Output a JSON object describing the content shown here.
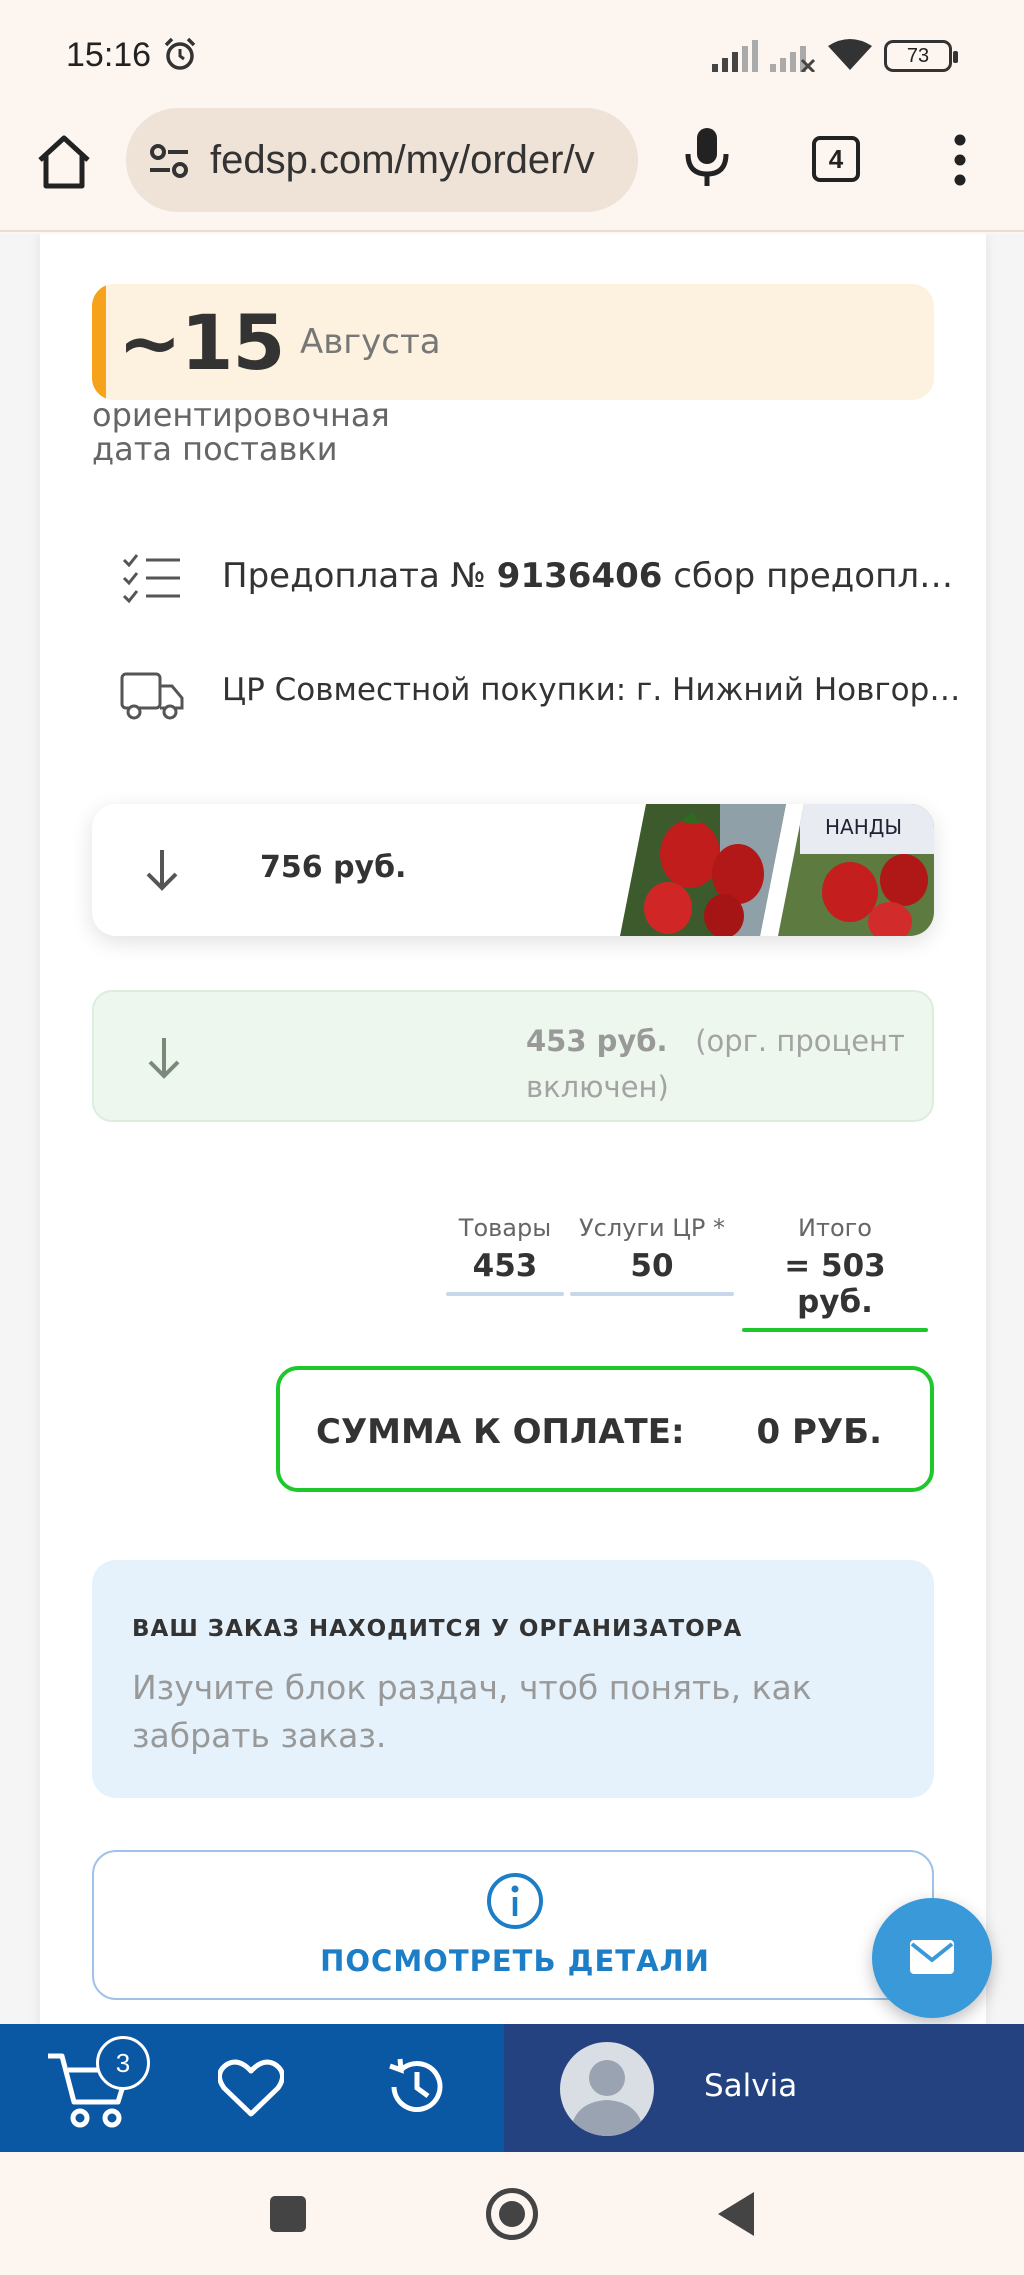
{
  "status_bar": {
    "time": "15:16",
    "battery": "73",
    "icons": [
      "alarm-icon",
      "signal-icon",
      "signal-no-data-icon",
      "wifi-icon",
      "battery-icon"
    ]
  },
  "browser": {
    "url": "fedsp.com/my/order/v",
    "tab_count": "4",
    "icons": [
      "home-icon",
      "site-settings-icon",
      "microphone-icon",
      "tabs-icon",
      "more-menu-icon"
    ]
  },
  "order": {
    "delivery": {
      "day": "~15",
      "month": "Августа",
      "caption_line1": "ориентировочная",
      "caption_line2": "дата поставки"
    },
    "prepay": {
      "prefix": "Предоплата № ",
      "number": "9136406",
      "suffix": " сбор предоплаты"
    },
    "pickup": "ЦР Совместной покупки: г. Нижний Новгород,",
    "item_price": "756 руб.",
    "org_price": "453 руб.",
    "org_note": "(орг. процент включен)",
    "totals": {
      "goods_label": "Товары",
      "goods_value": "453",
      "services_label": "Услуги ЦР *",
      "services_value": "50",
      "total_label": "Итого",
      "total_value": "= 503 руб."
    },
    "payment": {
      "label": "СУММА К ОПЛАТЕ:",
      "value": "0 РУБ."
    },
    "notice": {
      "title": "ВАШ ЗАКАЗ НАХОДИТСЯ У ОРГАНИЗАТОРА",
      "text": "Изучите блок раздач, чтоб понять, как забрать заказ."
    },
    "details_button": "ПОСМОТРЕТЬ ДЕТАЛИ"
  },
  "app_bar": {
    "cart_count": "3",
    "user_name": "Salvia"
  },
  "colors": {
    "accent_orange": "#f7a21b",
    "accent_green": "#1ec72a",
    "link_blue": "#1c7ec7",
    "appbar_blue": "#0a57a4",
    "appbar_user": "#24427f"
  }
}
